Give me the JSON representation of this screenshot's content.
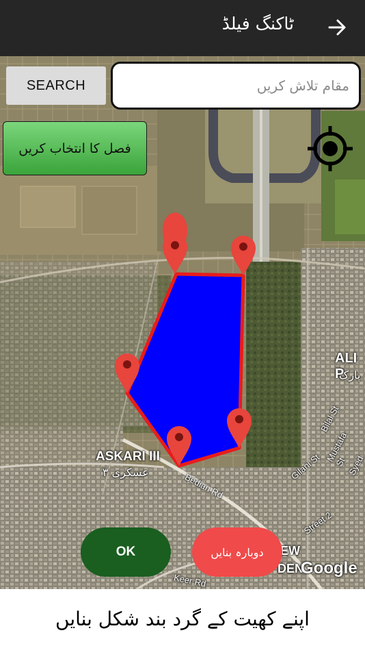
{
  "appbar": {
    "title": "ٹاکنگ فیلڈ",
    "back_icon": "arrow-right-icon"
  },
  "search": {
    "button_label": "SEARCH",
    "placeholder": "مقام تلاش کریں",
    "value": ""
  },
  "crop_button": {
    "label": "فصل کا انتخاب کریں",
    "color": "#4caf50"
  },
  "locate_icon": "crosshair-icon",
  "map": {
    "labels": {
      "askari": "ASKARI III",
      "askari_urdu": "عسکری ۳",
      "ali": "ALI P",
      "park": "پارک",
      "new": "EW",
      "garden": "DEN",
      "google": "Google",
      "bedian": "Bedian Rd",
      "bilal": "Bilal St",
      "mustafa": "Mustafa St",
      "syed": "Syed",
      "gilani": "Gilani St",
      "jalal": "Jalal St",
      "street2": "Street 2",
      "keer": "Keer Rd"
    },
    "polygon_fill": "#0000ff",
    "polygon_stroke": "#e81c1c",
    "marker_color": "#e8453c",
    "marker_icon": "map-pin-icon"
  },
  "actions": {
    "ok_label": "OK",
    "ok_color": "#1a5e20",
    "redo_label": "دوبارہ بنایں",
    "redo_color": "#f04a4a"
  },
  "footer": {
    "instruction": "اپنے کھیت کے گرد بند شکل بنایں"
  }
}
